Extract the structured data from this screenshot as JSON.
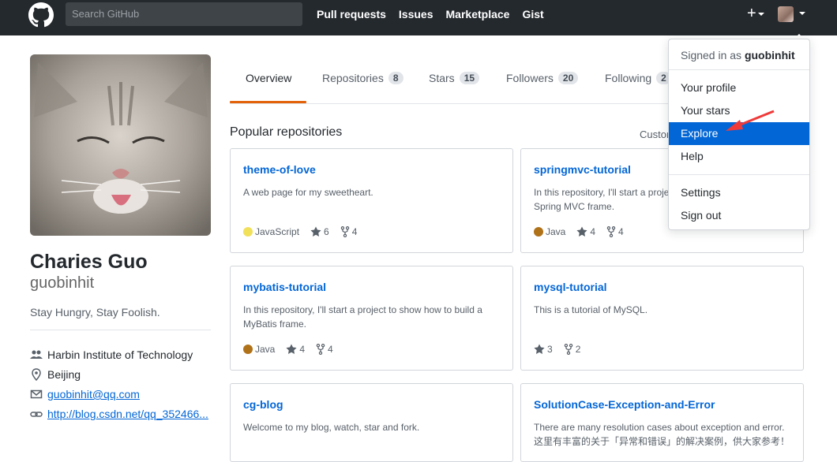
{
  "header": {
    "search_placeholder": "Search GitHub",
    "nav": [
      "Pull requests",
      "Issues",
      "Marketplace",
      "Gist"
    ],
    "plus": "+"
  },
  "profile": {
    "fullname": "Charies Guo",
    "username": "guobinhit",
    "bio": "Stay Hungry, Stay Foolish.",
    "organization": "Harbin Institute of Technology",
    "location": "Beijing",
    "email": "guobinhit@qq.com",
    "website": "http://blog.csdn.net/qq_352466..."
  },
  "tabs": [
    {
      "label": "Overview",
      "count": null
    },
    {
      "label": "Repositories",
      "count": "8"
    },
    {
      "label": "Stars",
      "count": "15"
    },
    {
      "label": "Followers",
      "count": "20"
    },
    {
      "label": "Following",
      "count": "2"
    }
  ],
  "popular": {
    "title": "Popular repositories",
    "customize": "Custom"
  },
  "repos": [
    {
      "name": "theme-of-love",
      "desc": "A web page for my sweetheart.",
      "lang": "JavaScript",
      "lang_color": "#f1e05a",
      "stars": "6",
      "forks": "4"
    },
    {
      "name": "springmvc-tutorial",
      "desc": "In this repository, I'll start a proje\nSpring MVC frame.",
      "lang": "Java",
      "lang_color": "#b07219",
      "stars": "4",
      "forks": "4"
    },
    {
      "name": "mybatis-tutorial",
      "desc": "In this repository, I'll start a project to show how to build a MyBatis frame.",
      "lang": "Java",
      "lang_color": "#b07219",
      "stars": "4",
      "forks": "4"
    },
    {
      "name": "mysql-tutorial",
      "desc": "This is a tutorial of MySQL.",
      "lang": "",
      "lang_color": "",
      "stars": "3",
      "forks": "2"
    },
    {
      "name": "cg-blog",
      "desc": "Welcome to my blog, watch, star and fork.",
      "lang": "",
      "lang_color": "",
      "stars": "",
      "forks": ""
    },
    {
      "name": "SolutionCase-Exception-and-Error",
      "desc": "There are many resolution cases about exception and error.\n这里有丰富的关于「异常和错误」的解决案例，供大家参考！",
      "lang": "",
      "lang_color": "",
      "stars": "",
      "forks": ""
    }
  ],
  "dropdown": {
    "signed_in_prefix": "Signed in as",
    "signed_in_user": "guobinhit",
    "items": [
      "Your profile",
      "Your stars",
      "Explore",
      "Help",
      "Settings",
      "Sign out"
    ],
    "active": "Explore"
  },
  "colors": {
    "header_bg": "#24292e",
    "link": "#0366d6",
    "tab_active_underline": "#e36209",
    "annotation_arrow": "#f03a3a"
  }
}
